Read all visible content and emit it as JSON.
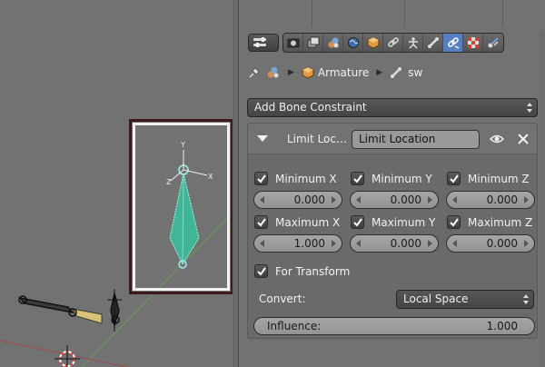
{
  "breadcrumb": {
    "object": "Armature",
    "bone": "sw"
  },
  "add_constraint": {
    "label": "Add Bone Constraint"
  },
  "constraint": {
    "type_label": "Limit Loc…",
    "name": "Limit Location",
    "min_x": {
      "label": "Minimum X",
      "checked": true,
      "value": "0.000"
    },
    "min_y": {
      "label": "Minimum Y",
      "checked": true,
      "value": "0.000"
    },
    "min_z": {
      "label": "Minimum Z",
      "checked": true,
      "value": "0.000"
    },
    "max_x": {
      "label": "Maximum X",
      "checked": true,
      "value": "1.000"
    },
    "max_y": {
      "label": "Maximum Y",
      "checked": true,
      "value": "0.000"
    },
    "max_z": {
      "label": "Maximum Z",
      "checked": true,
      "value": "0.000"
    },
    "for_transform": {
      "label": "For Transform",
      "checked": true
    },
    "convert_label": "Convert:",
    "convert_value": "Local Space",
    "influence_label": "Influence:",
    "influence_value": "1.000"
  },
  "tabs": [
    "render-icon",
    "render-layers-icon",
    "scene-icon",
    "world-icon",
    "object-icon",
    "constraints-icon",
    "modifiers-icon",
    "object-data-icon",
    "bone-icon",
    "bone-constraints-icon",
    "texture-icon",
    "particles-icon"
  ],
  "active_tab": "bone-constraints-icon",
  "viewport_axes": {
    "x": "X",
    "y": "Y",
    "z": "Z"
  },
  "colors": {
    "active_tab": "#5680c2",
    "bone": "#41b596",
    "selection_frame": "#3a1a1a"
  }
}
